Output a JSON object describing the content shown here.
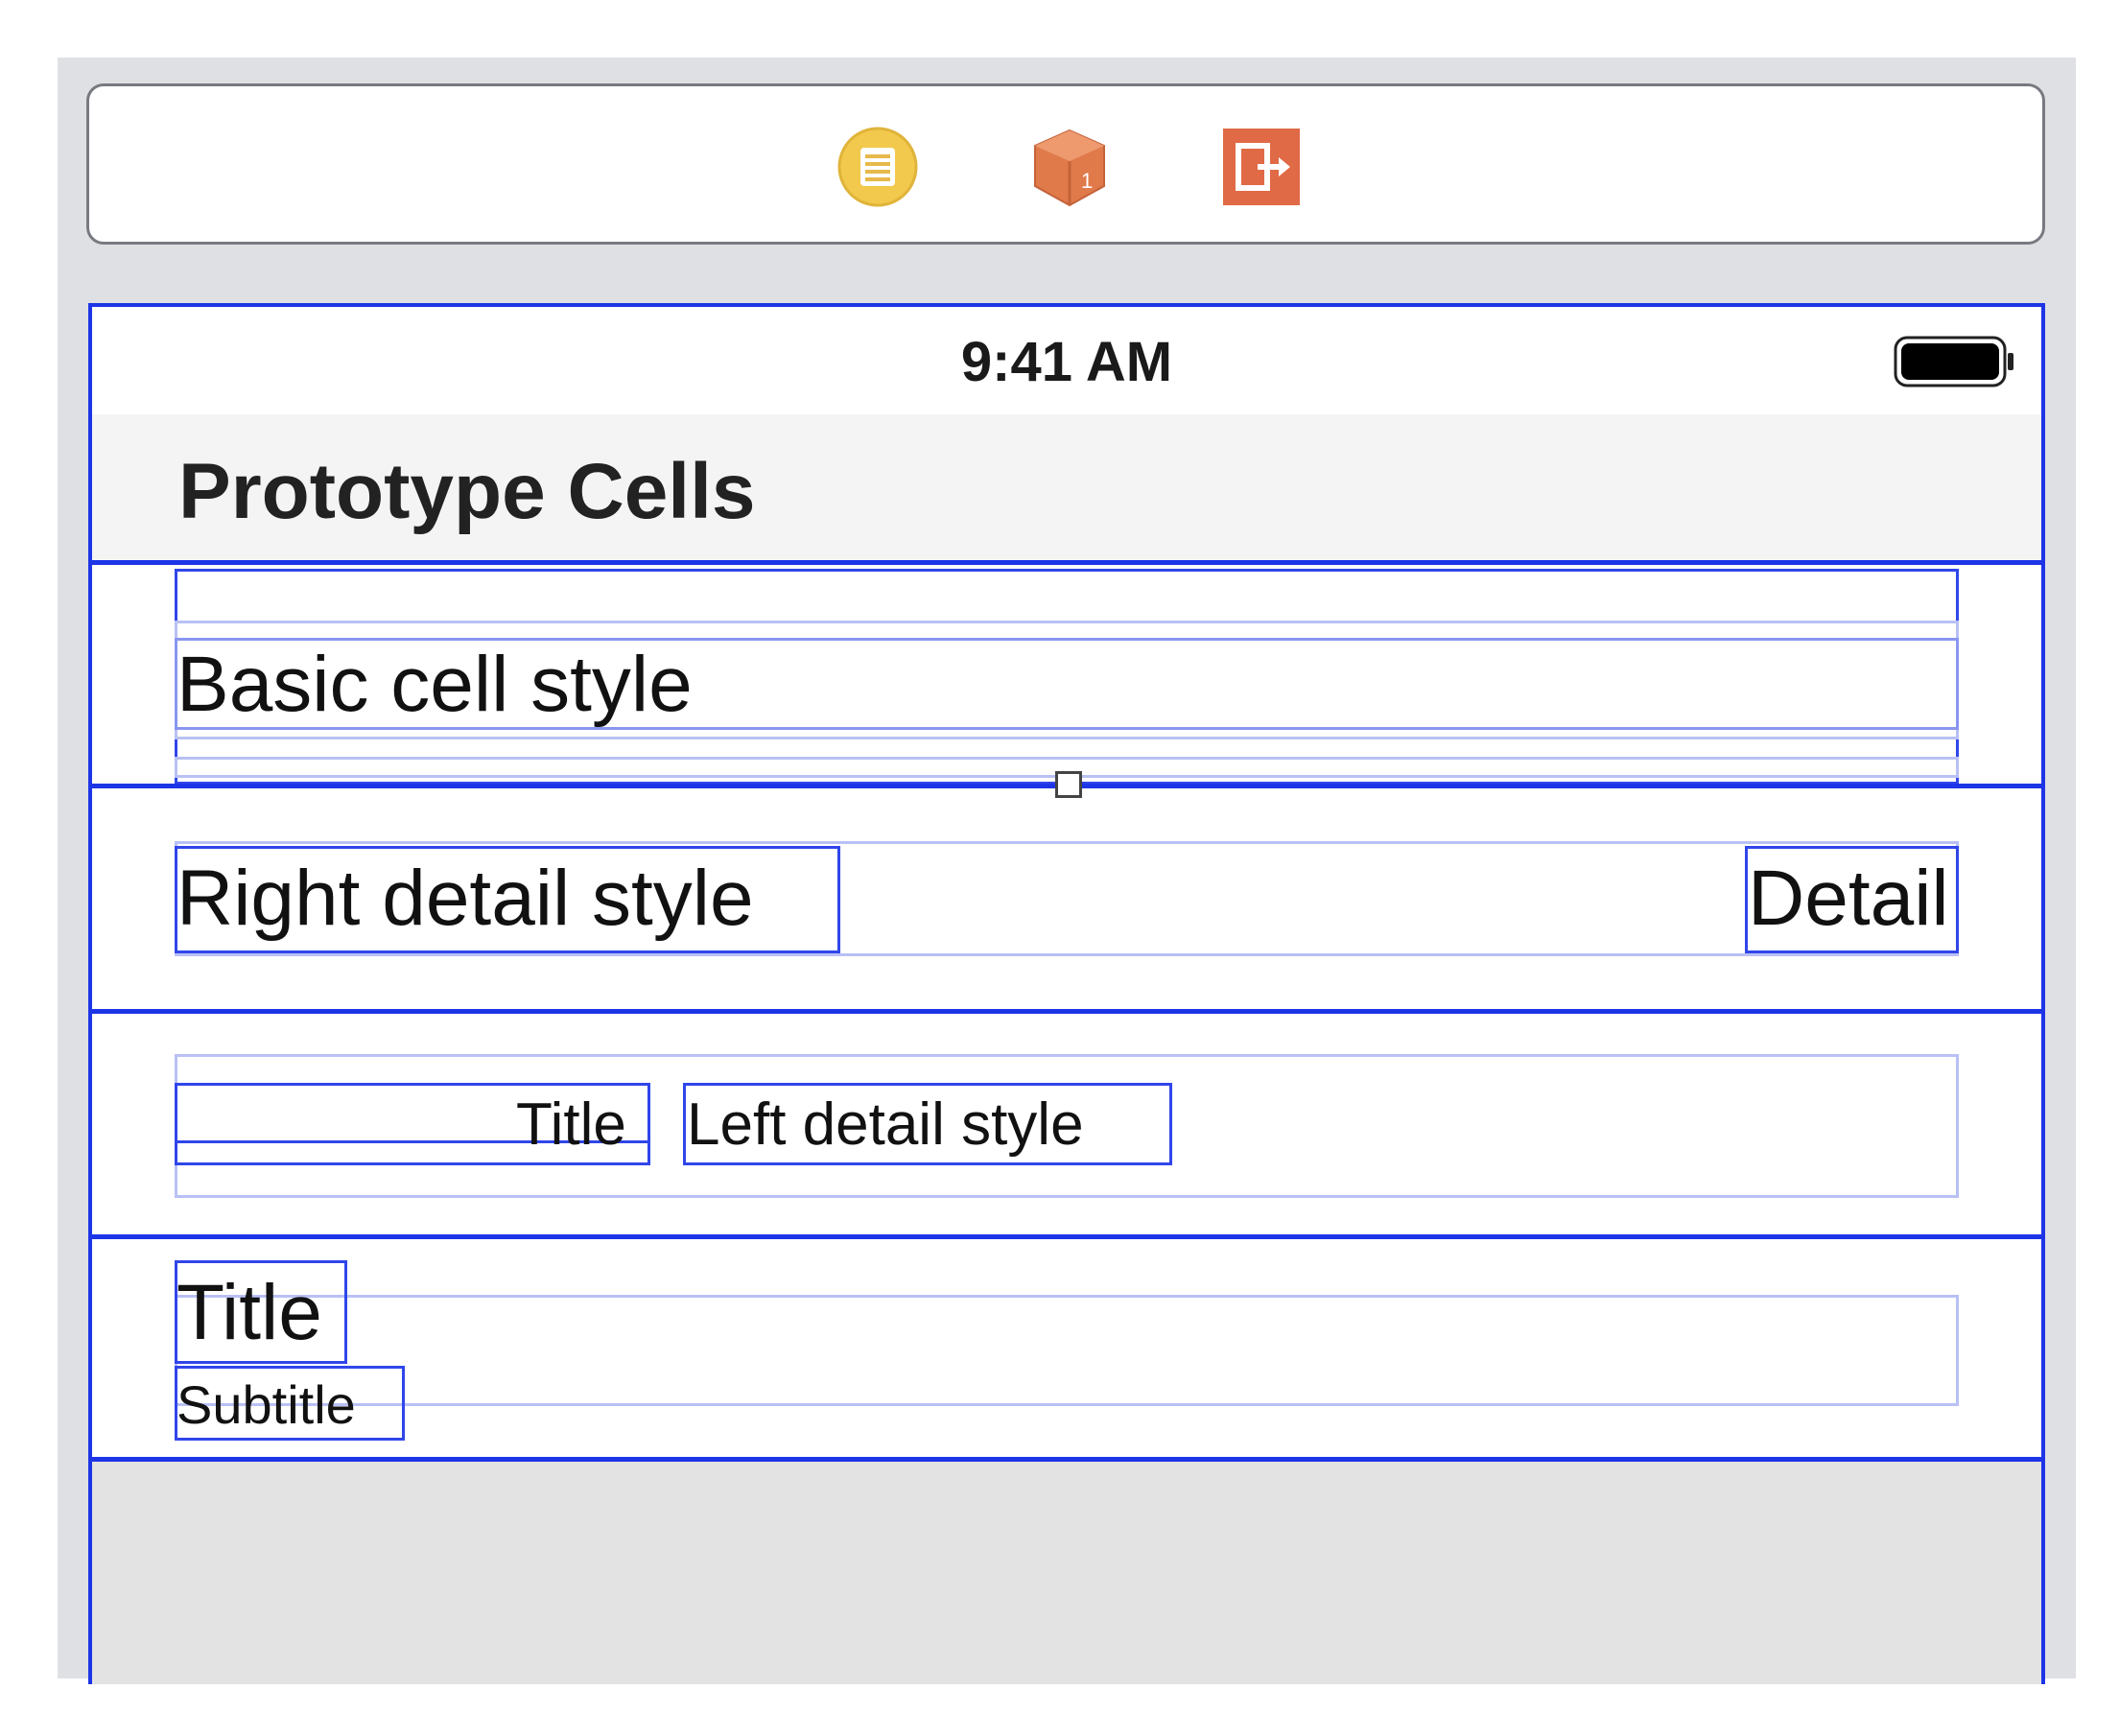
{
  "dock": {
    "icons": [
      {
        "name": "view-controller-icon",
        "color": "#f2c94c"
      },
      {
        "name": "first-responder-icon",
        "color": "#e07a4a"
      },
      {
        "name": "exit-icon",
        "color": "#e06a45"
      }
    ]
  },
  "status_bar": {
    "time": "9:41 AM"
  },
  "table": {
    "header_title": "Prototype Cells",
    "cells": {
      "basic": {
        "title": "Basic cell style"
      },
      "right_detail": {
        "title": "Right detail style",
        "detail": "Detail"
      },
      "left_detail": {
        "title": "Title",
        "detail": "Left detail style"
      },
      "subtitle": {
        "title": "Title",
        "subtitle": "Subtitle"
      }
    }
  },
  "colors": {
    "canvas_bg": "#dfe0e3",
    "selection_blue": "#1d35e6",
    "header_bg": "#f4f4f4",
    "empty_area_bg": "#e3e3e3"
  }
}
